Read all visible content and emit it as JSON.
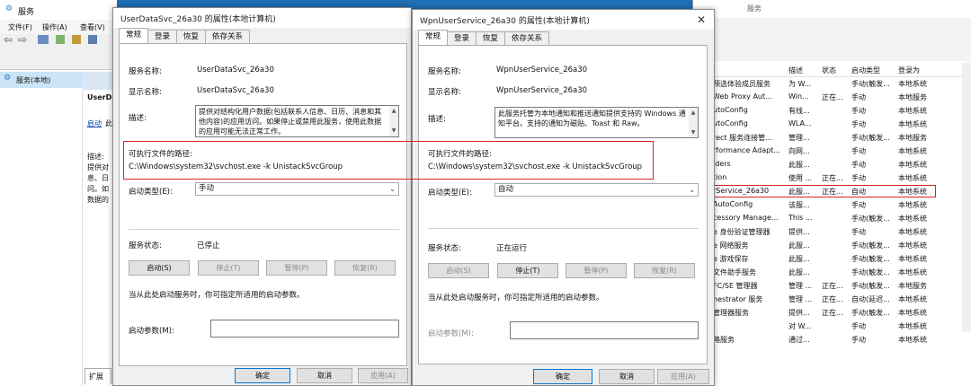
{
  "services_window": {
    "title": "服务",
    "menu": [
      "文件(F)",
      "操作(A)",
      "查看(V)"
    ],
    "tree_item": "服务(本地)",
    "detail_title": "UserDa",
    "detail_link": "启动",
    "detail_link_suffix": "此服",
    "desc_lines": [
      "描述:",
      "提供对",
      "息、日",
      "问。如",
      "数据的"
    ],
    "tab_expand": "扩展"
  },
  "right_list": {
    "title": "服务",
    "headers": [
      "描述",
      "状态",
      "启动类型",
      "登录为"
    ],
    "rows": [
      {
        "name": "预选体验成员服务",
        "desc": "为 W...",
        "status": "",
        "start": "手动(触发...",
        "logon": "本地系统"
      },
      {
        "name": "Web Proxy Aut...",
        "desc": "Win...",
        "status": "正在...",
        "start": "手动",
        "logon": "本地服务"
      },
      {
        "name": "utoConfig",
        "desc": "有线...",
        "status": "",
        "start": "手动",
        "logon": "本地系统"
      },
      {
        "name": "utoConfig",
        "desc": "WLA...",
        "status": "",
        "start": "手动",
        "logon": "本地系统"
      },
      {
        "name": "rect 服务连接管...",
        "desc": "管理...",
        "status": "",
        "start": "手动(触发...",
        "logon": "本地服务"
      },
      {
        "name": "rformance Adapt...",
        "desc": "向网...",
        "status": "",
        "start": "手动",
        "logon": "本地系统"
      },
      {
        "name": "lders",
        "desc": "此服...",
        "status": "",
        "start": "手动",
        "logon": "本地系统"
      },
      {
        "name": "tion",
        "desc": "使用 ...",
        "status": "正在...",
        "start": "手动",
        "logon": "本地系统"
      },
      {
        "name": "rService_26a30",
        "desc": "此服...",
        "status": "正在...",
        "start": "自动",
        "logon": "本地系统"
      },
      {
        "name": "AutoConfig",
        "desc": "该服...",
        "status": "",
        "start": "手动",
        "logon": "本地系统"
      },
      {
        "name": "cessory Manage...",
        "desc": "This ...",
        "status": "",
        "start": "手动(触发...",
        "logon": "本地系统"
      },
      {
        "name": "e 身份验证管理器",
        "desc": "提供...",
        "status": "",
        "start": "手动",
        "logon": "本地系统"
      },
      {
        "name": "e 网络服务",
        "desc": "此服...",
        "status": "",
        "start": "手动(触发...",
        "logon": "本地系统"
      },
      {
        "name": "e 游戏保存",
        "desc": "此服...",
        "status": "",
        "start": "手动(触发...",
        "logon": "本地系统"
      },
      {
        "name": "文件助手服务",
        "desc": "此服...",
        "status": "",
        "start": "手动(触发...",
        "logon": "本地系统"
      },
      {
        "name": "FC/SE 管理器",
        "desc": "管理 ...",
        "status": "正在...",
        "start": "手动(触发...",
        "logon": "本地服务"
      },
      {
        "name": "hestrator 服务",
        "desc": "管理 ...",
        "status": "正在...",
        "start": "自动(延迟...",
        "logon": "本地系统"
      },
      {
        "name": "管理器服务",
        "desc": "提供...",
        "status": "正在...",
        "start": "手动(触发...",
        "logon": "本地系统"
      },
      {
        "name": "",
        "desc": "对 W...",
        "status": "",
        "start": "手动",
        "logon": "本地系统"
      },
      {
        "name": "略服务",
        "desc": "通过...",
        "status": "",
        "start": "手动",
        "logon": "本地系统"
      }
    ]
  },
  "dialog1": {
    "title": "UserDataSvc_26a30 的属性(本地计算机)",
    "tabs": [
      "常规",
      "登录",
      "恢复",
      "依存关系"
    ],
    "service_name_label": "服务名称:",
    "service_name": "UserDataSvc_26a30",
    "display_name_label": "显示名称:",
    "display_name": "UserDataSvc_26a30",
    "description_label": "描述:",
    "description": "提供对结构化用户数据(包括联系人信息、日历、消息和其他内容)的应用访问。如果停止或禁用此服务，使用此数据的应用可能无法正常工作。",
    "path_label": "可执行文件的路径:",
    "path": "C:\\Windows\\system32\\svchost.exe -k UnistackSvcGroup",
    "startup_type_label": "启动类型(E):",
    "startup_type": "手动",
    "status_label": "服务状态:",
    "status": "已停止",
    "buttons": {
      "start": "启动(S)",
      "stop": "停止(T)",
      "pause": "暂停(P)",
      "resume": "恢复(R)"
    },
    "hint": "当从此处启动服务时，你可指定所适用的启动参数。",
    "params_label": "启动参数(M):",
    "params_value": "",
    "ok": "确定",
    "cancel": "取消",
    "apply": "应用(A)"
  },
  "dialog2": {
    "title": "WpnUserService_26a30 的属性(本地计算机)",
    "tabs": [
      "常规",
      "登录",
      "恢复",
      "依存关系"
    ],
    "service_name_label": "服务名称:",
    "service_name": "WpnUserService_26a30",
    "display_name_label": "显示名称:",
    "display_name": "WpnUserService_26a30",
    "description_label": "描述:",
    "description": "此服务托管为本地通知和推送通知提供支持的 Windows 通知平台。支持的通知为磁贴、Toast 和 Raw。",
    "path_label": "可执行文件的路径:",
    "path": "C:\\Windows\\system32\\svchost.exe -k UnistackSvcGroup",
    "startup_type_label": "启动类型(E):",
    "startup_type": "自动",
    "status_label": "服务状态:",
    "status": "正在运行",
    "buttons": {
      "start": "启动(S)",
      "stop": "停止(T)",
      "pause": "暂停(P)",
      "resume": "恢复(R)"
    },
    "hint": "当从此处启动服务时，你可指定所适用的启动参数。",
    "params_label": "启动参数(M):",
    "params_value": "",
    "ok": "确定",
    "cancel": "取消",
    "apply": "应用(A)"
  },
  "colors": {
    "highlight": "#d62424",
    "accent": "#0078d7"
  }
}
